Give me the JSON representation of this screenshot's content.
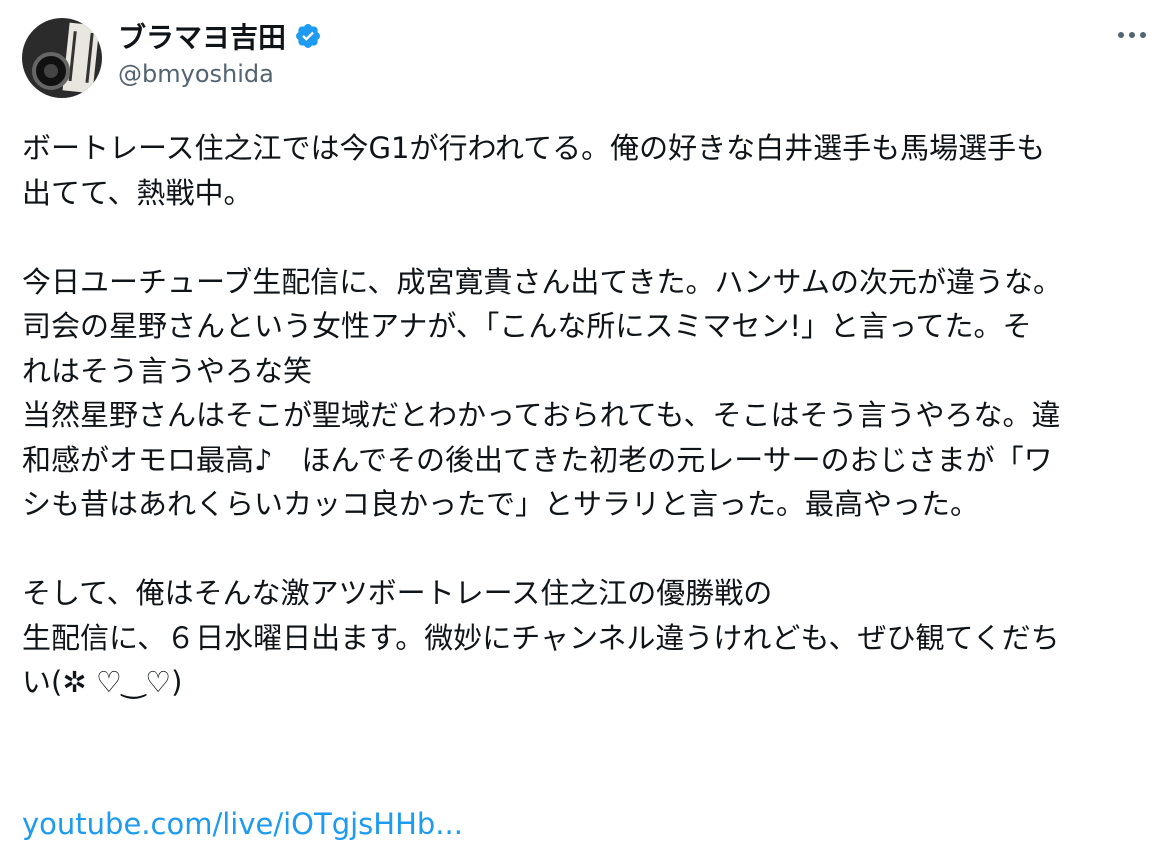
{
  "author": {
    "display_name": "ブラマヨ吉田",
    "handle": "@bmyoshida",
    "avatar_icon": "profile-photo",
    "verified_icon": "verified-badge-icon",
    "verified_color": "#1d9bf0"
  },
  "more_icon": "more-options-icon",
  "tweet": {
    "lines": [
      "ボートレース住之江では今G1が行われてる。俺の好きな白井選手も馬場選手も",
      "出てて、熱戦中。",
      "",
      "今日ユーチューブ生配信に、成宮寛貴さん出てきた。ハンサムの次元が違うな。",
      "司会の星野さんという女性アナが、「こんな所にスミマセン!」と言ってた。そ",
      "れはそう言うやろな笑",
      "当然星野さんはそこが聖域だとわかっておられても、そこはそう言うやろな。違",
      "和感がオモロ最高♪　ほんでその後出てきた初老の元レーサーのおじさまが「ワ",
      "シも昔はあれくらいカッコ良かったで」とサラリと言った。最高やった。",
      "",
      "そして、俺はそんな激アツボートレース住之江の優勝戦の",
      "生配信に、６日水曜日出ます。微妙にチャンネル違うけれども、ぜひ観てくだち",
      "い(✲ ♡‿♡)"
    ],
    "link_text": "youtube.com/live/iOTgjsHHb...",
    "link_color": "#1d9bf0"
  }
}
